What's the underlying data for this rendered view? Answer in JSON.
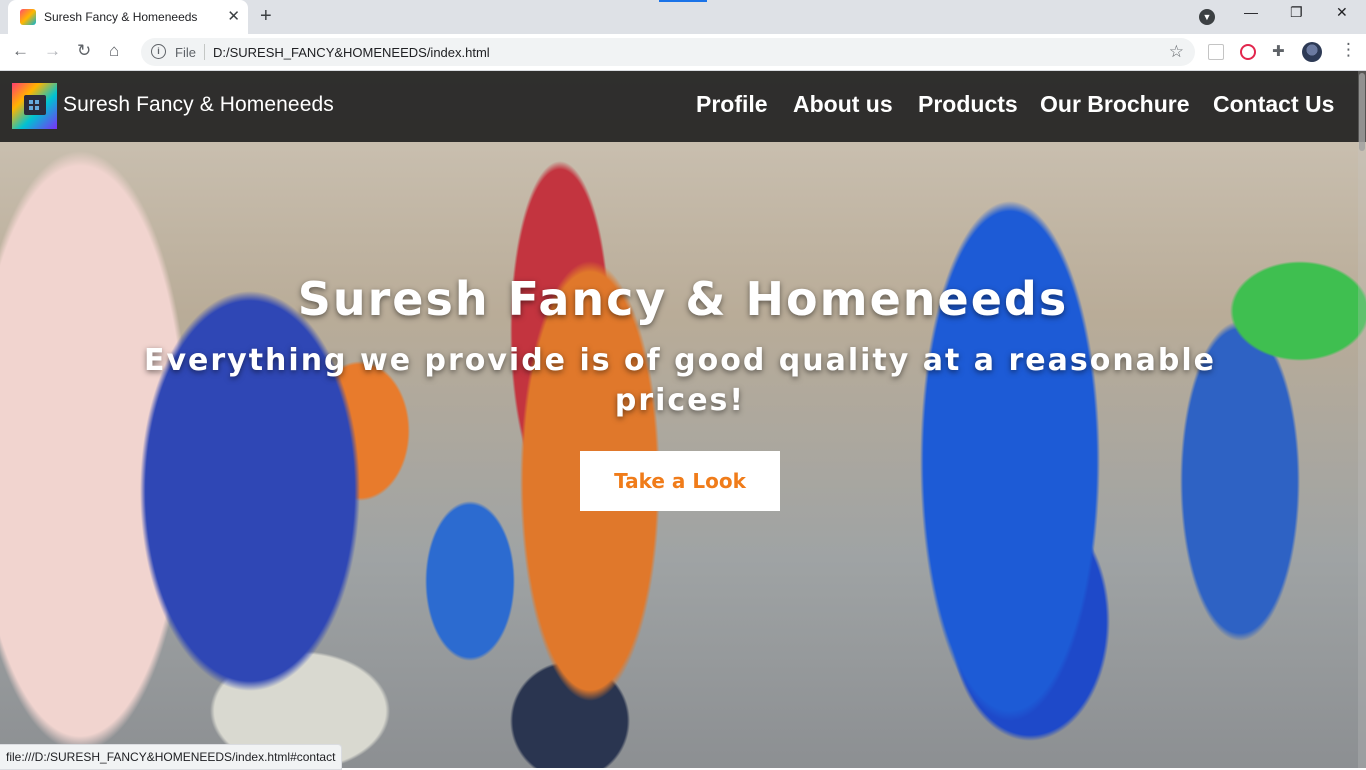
{
  "browser": {
    "tab_title": "Suresh Fancy & Homeneeds",
    "file_label": "File",
    "url": "D:/SURESH_FANCY&HOMENEEDS/index.html",
    "status_url": "file:///D:/SURESH_FANCY&HOMENEEDS/index.html#contact"
  },
  "navbar": {
    "brand": "Suresh Fancy & Homeneeds",
    "links": [
      "Profile",
      "About us",
      "Products",
      "Our Brochure",
      "Contact Us"
    ]
  },
  "hero": {
    "title": "Suresh Fancy & Homeneeds",
    "subtitle": "Everything we provide is of good quality at a reasonable prices!",
    "cta_label": "Take a Look"
  },
  "colors": {
    "cta_text": "#f07c1a",
    "navbar_bg": "#1e1e1e"
  }
}
